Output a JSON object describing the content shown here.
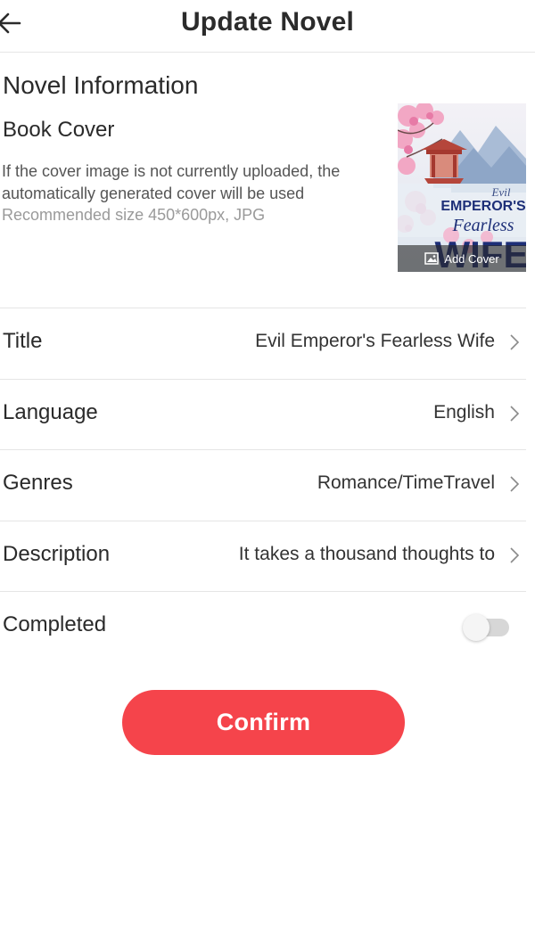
{
  "header": {
    "title": "Update Novel"
  },
  "novel_info": {
    "section_title": "Novel Information",
    "cover_label": "Book Cover",
    "cover_note": "If the cover image is not currently uploaded, the automatically generated cover will be used",
    "cover_size_hint": "Recommended size 450*600px, JPG",
    "cover": {
      "title_line1": "Evil",
      "title_line2": "EMPEROR'S",
      "title_line3": "Fearless",
      "title_line4": "WIFE",
      "add_cover_label": "Add Cover"
    }
  },
  "fields": {
    "title": {
      "label": "Title",
      "value": "Evil Emperor's Fearless Wife"
    },
    "language": {
      "label": "Language",
      "value": "English"
    },
    "genres": {
      "label": "Genres",
      "value": "Romance/TimeTravel"
    },
    "description": {
      "label": "Description",
      "value": "It takes a thousand thoughts to"
    },
    "completed": {
      "label": "Completed",
      "enabled": false
    }
  },
  "confirm_label": "Confirm",
  "colors": {
    "accent": "#f5444b",
    "toggle_off_track": "#d7d7d7",
    "divider": "#e5e5e5"
  }
}
